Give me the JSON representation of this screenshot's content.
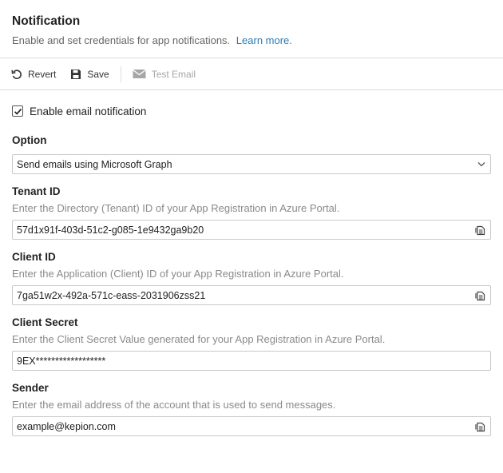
{
  "header": {
    "title": "Notification",
    "subtitle": "Enable and set credentials for app notifications.",
    "learn_more": "Learn more."
  },
  "toolbar": {
    "revert_label": "Revert",
    "save_label": "Save",
    "test_email_label": "Test Email"
  },
  "enable_email": {
    "label": "Enable email notification",
    "checked": true
  },
  "option": {
    "label": "Option",
    "selected": "Send emails using Microsoft Graph"
  },
  "tenant": {
    "label": "Tenant ID",
    "description": "Enter the Directory (Tenant) ID of your App Registration in Azure Portal.",
    "value": "57d1x91f-403d-51c2-g085-1e9432ga9b20"
  },
  "client": {
    "label": "Client ID",
    "description": "Enter the Application (Client) ID of your App Registration in Azure Portal.",
    "value": "7ga51w2x-492a-571c-eass-2031906zss21"
  },
  "secret": {
    "label": "Client Secret",
    "description": "Enter the Client Secret Value generated for your App Registration in Azure Portal.",
    "value": "9EX******************"
  },
  "sender": {
    "label": "Sender",
    "description": "Enter the email address of the account that is used to send messages.",
    "value": "example@kepion.com"
  },
  "colors": {
    "link": "#2a7ab8",
    "border": "#c9c9c9",
    "muted": "#8a8a8a",
    "disabled": "#a6a6a6"
  },
  "icons": {
    "revert": "revert-icon",
    "save": "save-icon",
    "test_email": "mail-icon",
    "copy": "copy-icon",
    "dropdown": "chevron-down-icon",
    "checkbox": "checkmark-icon"
  }
}
